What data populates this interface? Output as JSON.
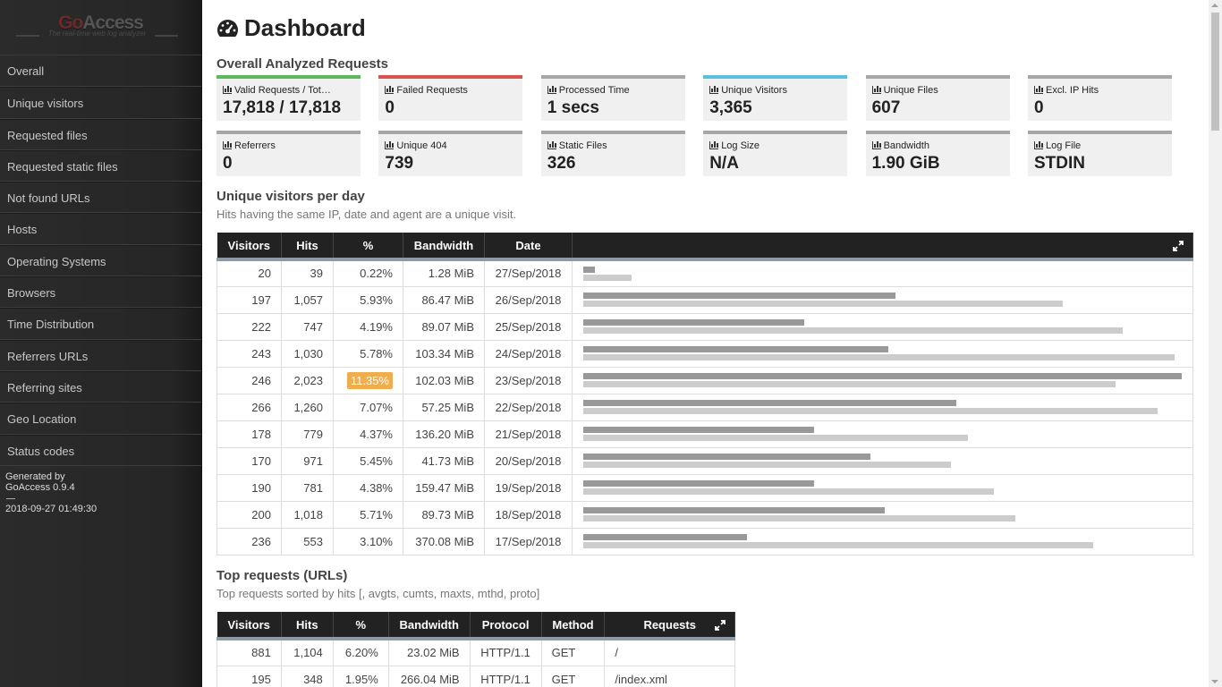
{
  "sidebar": {
    "logo_brand_a": "Go",
    "logo_brand_b": "Access",
    "logo_tagline": "The real-time web log analyzer",
    "items": [
      {
        "label": "Overall"
      },
      {
        "label": "Unique visitors"
      },
      {
        "label": "Requested files"
      },
      {
        "label": "Requested static files"
      },
      {
        "label": "Not found URLs"
      },
      {
        "label": "Hosts"
      },
      {
        "label": "Operating Systems"
      },
      {
        "label": "Browsers"
      },
      {
        "label": "Time Distribution"
      },
      {
        "label": "Referrers URLs"
      },
      {
        "label": "Referring sites"
      },
      {
        "label": "Geo Location"
      },
      {
        "label": "Status codes"
      }
    ],
    "generated_by": "Generated by",
    "version": "GoAccess 0.9.4",
    "timestamp": "2018-09-27 01:49:30"
  },
  "header": {
    "title": "Dashboard",
    "icon": "tachometer-icon"
  },
  "overall": {
    "title": "Overall Analyzed Requests",
    "cards": [
      {
        "label": "Valid Requests / Tot…",
        "value": "17,818 / 17,818",
        "color": "#5cb85c"
      },
      {
        "label": "Failed Requests",
        "value": "0",
        "color": "#d9534f"
      },
      {
        "label": "Processed Time",
        "value": "1 secs",
        "color": "#a7a7a7"
      },
      {
        "label": "Unique Visitors",
        "value": "3,365",
        "color": "#5bc0de"
      },
      {
        "label": "Unique Files",
        "value": "607",
        "color": "#a7a7a7"
      },
      {
        "label": "Excl. IP Hits",
        "value": "0",
        "color": "#a7a7a7"
      },
      {
        "label": "Referrers",
        "value": "0",
        "color": "#a7a7a7"
      },
      {
        "label": "Unique 404",
        "value": "739",
        "color": "#a7a7a7"
      },
      {
        "label": "Static Files",
        "value": "326",
        "color": "#a7a7a7"
      },
      {
        "label": "Log Size",
        "value": "N/A",
        "color": "#a7a7a7"
      },
      {
        "label": "Bandwidth",
        "value": "1.90 GiB",
        "color": "#a7a7a7"
      },
      {
        "label": "Log File",
        "value": "STDIN",
        "color": "#a7a7a7"
      }
    ]
  },
  "visitors": {
    "title": "Unique visitors per day",
    "desc": "Hits having the same IP, date and agent are a unique visit.",
    "headers": [
      "Visitors",
      "Hits",
      "%",
      "Bandwidth",
      "Date"
    ],
    "highlight_color": "#f0ad4e",
    "rows": [
      {
        "visitors": "20",
        "hits": "39",
        "pct": "0.22%",
        "bw": "1.28 MiB",
        "date": "27/Sep/2018",
        "hits_level": 0.019,
        "visitors_level": 0.081
      },
      {
        "visitors": "197",
        "hits": "1,057",
        "pct": "5.93%",
        "bw": "86.47 MiB",
        "date": "26/Sep/2018",
        "hits_level": 0.522,
        "visitors_level": 0.801
      },
      {
        "visitors": "222",
        "hits": "747",
        "pct": "4.19%",
        "bw": "89.07 MiB",
        "date": "25/Sep/2018",
        "hits_level": 0.369,
        "visitors_level": 0.902
      },
      {
        "visitors": "243",
        "hits": "1,030",
        "pct": "5.78%",
        "bw": "103.34 MiB",
        "date": "24/Sep/2018",
        "hits_level": 0.509,
        "visitors_level": 0.988
      },
      {
        "visitors": "246",
        "hits": "2,023",
        "pct": "11.35%",
        "bw": "102.03 MiB",
        "date": "23/Sep/2018",
        "hits_level": 1.0,
        "visitors_level": 0.889,
        "highlight": true
      },
      {
        "visitors": "266",
        "hits": "1,260",
        "pct": "7.07%",
        "bw": "57.25 MiB",
        "date": "22/Sep/2018",
        "hits_level": 0.623,
        "visitors_level": 0.96
      },
      {
        "visitors": "178",
        "hits": "779",
        "pct": "4.37%",
        "bw": "136.20 MiB",
        "date": "21/Sep/2018",
        "hits_level": 0.385,
        "visitors_level": 0.643
      },
      {
        "visitors": "170",
        "hits": "971",
        "pct": "5.45%",
        "bw": "41.73 MiB",
        "date": "20/Sep/2018",
        "hits_level": 0.48,
        "visitors_level": 0.614
      },
      {
        "visitors": "190",
        "hits": "781",
        "pct": "4.38%",
        "bw": "159.47 MiB",
        "date": "19/Sep/2018",
        "hits_level": 0.386,
        "visitors_level": 0.686
      },
      {
        "visitors": "200",
        "hits": "1,018",
        "pct": "5.71%",
        "bw": "89.73 MiB",
        "date": "18/Sep/2018",
        "hits_level": 0.503,
        "visitors_level": 0.722
      },
      {
        "visitors": "236",
        "hits": "553",
        "pct": "3.10%",
        "bw": "370.08 MiB",
        "date": "17/Sep/2018",
        "hits_level": 0.273,
        "visitors_level": 0.852
      }
    ]
  },
  "requests": {
    "title": "Top requests (URLs)",
    "desc": "Top requests sorted by hits [, avgts, cumts, maxts, mthd, proto]",
    "headers": [
      "Visitors",
      "Hits",
      "%",
      "Bandwidth",
      "Protocol",
      "Method",
      "Requests"
    ],
    "rows": [
      {
        "visitors": "881",
        "hits": "1,104",
        "pct": "6.20%",
        "bw": "23.02 MiB",
        "proto": "HTTP/1.1",
        "method": "GET",
        "req": "/"
      },
      {
        "visitors": "195",
        "hits": "348",
        "pct": "1.95%",
        "bw": "266.04 MiB",
        "proto": "HTTP/1.1",
        "method": "GET",
        "req": "/index.xml"
      }
    ]
  }
}
